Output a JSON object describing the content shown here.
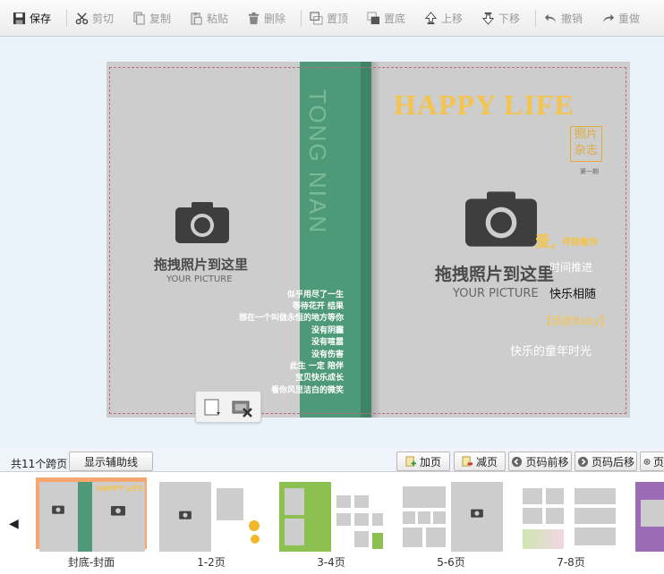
{
  "toolbar": {
    "save": "保存",
    "cut": "剪切",
    "copy": "复制",
    "paste": "粘贴",
    "delete": "删除",
    "bring_top": "置顶",
    "send_bottom": "置底",
    "move_up": "上移",
    "move_down": "下移",
    "undo": "撤销",
    "redo": "重做"
  },
  "cover": {
    "title": "HAPPY  LIFE",
    "stamp_line1": "照片",
    "stamp_line2": "杂志",
    "issue": "第一期",
    "spine": "TONG NIAN",
    "left_placeholder": {
      "cn": "拖拽照片到这里",
      "en": "YOUR PICTURE"
    },
    "right_placeholder": {
      "cn": "拖拽照片到这里",
      "en": "YOUR PICTURE"
    },
    "poem": [
      "似乎用尽了一生",
      "等待花开  结果",
      "想在一个叫做永恒的地方等你",
      "没有阴霾",
      "没有喧嚣",
      "没有伤害",
      "此生    一定  陪伴",
      "宝贝快乐成长",
      "看你风里洁白的微笑"
    ],
    "lines": {
      "love_big": "爱,",
      "love_small": "伴随着你",
      "time": "时间推进",
      "happy": "快乐相随",
      "baby": "【顽皮Baby】",
      "childhood": "快乐的童年时光"
    }
  },
  "controls": {
    "spread_count": "共11个跨页",
    "guides_button": "显示辅助线",
    "add_page": "加页",
    "remove_page": "减页",
    "page_forward": "页码前移",
    "page_backward": "页码后移",
    "page_extra": "页"
  },
  "thumbnails": [
    {
      "label": "封底-封面",
      "selected": true
    },
    {
      "label": "1-2页",
      "selected": false
    },
    {
      "label": "3-4页",
      "selected": false
    },
    {
      "label": "5-6页",
      "selected": false
    },
    {
      "label": "7-8页",
      "selected": false
    }
  ],
  "colors": {
    "spine_green": "#4e9a78",
    "title_gold": "#f3c44e",
    "selected_thumb": "#f6a66e",
    "dashed_guide": "#c06a7f"
  }
}
